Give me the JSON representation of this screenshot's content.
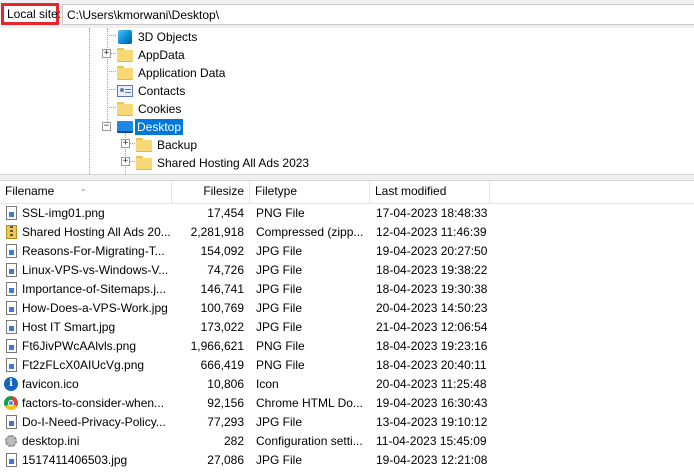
{
  "local_site": {
    "label": "Local site:",
    "path": "C:\\Users\\kmorwani\\Desktop\\"
  },
  "tree": {
    "items": [
      {
        "label": "3D Objects",
        "icon": "cube-icon",
        "expander": ""
      },
      {
        "label": "AppData",
        "icon": "folder-icon",
        "expander": "+"
      },
      {
        "label": "Application Data",
        "icon": "folder-icon",
        "expander": ""
      },
      {
        "label": "Contacts",
        "icon": "contacts-icon",
        "expander": ""
      },
      {
        "label": "Cookies",
        "icon": "folder-icon",
        "expander": ""
      },
      {
        "label": "Desktop",
        "icon": "desktop-icon",
        "expander": "−",
        "selected": true
      },
      {
        "label": "Backup",
        "icon": "folder-icon",
        "expander": "+"
      },
      {
        "label": "Shared Hosting All Ads 2023",
        "icon": "folder-icon",
        "expander": "+"
      }
    ]
  },
  "list": {
    "columns": {
      "filename": "Filename",
      "filesize": "Filesize",
      "filetype": "Filetype",
      "modified": "Last modified"
    },
    "rows": [
      {
        "name": "SSL-img01.png",
        "size": "17,454",
        "type": "PNG File",
        "modified": "17-04-2023 18:48:33",
        "icon": "image-file-icon"
      },
      {
        "name": "Shared Hosting All Ads 20...",
        "size": "2,281,918",
        "type": "Compressed (zipp...",
        "modified": "12-04-2023 11:46:39",
        "icon": "zip-file-icon"
      },
      {
        "name": "Reasons-For-Migrating-T...",
        "size": "154,092",
        "type": "JPG File",
        "modified": "19-04-2023 20:27:50",
        "icon": "image-file-icon"
      },
      {
        "name": "Linux-VPS-vs-Windows-V...",
        "size": "74,726",
        "type": "JPG File",
        "modified": "18-04-2023 19:38:22",
        "icon": "image-file-icon"
      },
      {
        "name": "Importance-of-Sitemaps.j...",
        "size": "146,741",
        "type": "JPG File",
        "modified": "18-04-2023 19:30:38",
        "icon": "image-file-icon"
      },
      {
        "name": "How-Does-a-VPS-Work.jpg",
        "size": "100,769",
        "type": "JPG File",
        "modified": "20-04-2023 14:50:23",
        "icon": "image-file-icon"
      },
      {
        "name": "Host IT Smart.jpg",
        "size": "173,022",
        "type": "JPG File",
        "modified": "21-04-2023 12:06:54",
        "icon": "image-file-icon"
      },
      {
        "name": "Ft6JivPWcAAlvls.png",
        "size": "1,966,621",
        "type": "PNG File",
        "modified": "18-04-2023 19:23:16",
        "icon": "image-file-icon"
      },
      {
        "name": "Ft2zFLcX0AIUcVg.png",
        "size": "666,419",
        "type": "PNG File",
        "modified": "18-04-2023 20:40:11",
        "icon": "image-file-icon"
      },
      {
        "name": "favicon.ico",
        "size": "10,806",
        "type": "Icon",
        "modified": "20-04-2023 11:25:48",
        "icon": "ico-file-icon"
      },
      {
        "name": "factors-to-consider-when...",
        "size": "92,156",
        "type": "Chrome HTML Do...",
        "modified": "19-04-2023 16:30:43",
        "icon": "chrome-icon"
      },
      {
        "name": "Do-I-Need-Privacy-Policy...",
        "size": "77,293",
        "type": "JPG File",
        "modified": "13-04-2023 19:10:12",
        "icon": "image-file-icon"
      },
      {
        "name": "desktop.ini",
        "size": "282",
        "type": "Configuration setti...",
        "modified": "11-04-2023 15:45:09",
        "icon": "settings-file-icon"
      },
      {
        "name": "1517411406503.jpg",
        "size": "27,086",
        "type": "JPG File",
        "modified": "19-04-2023 12:21:08",
        "icon": "image-file-icon"
      }
    ]
  }
}
